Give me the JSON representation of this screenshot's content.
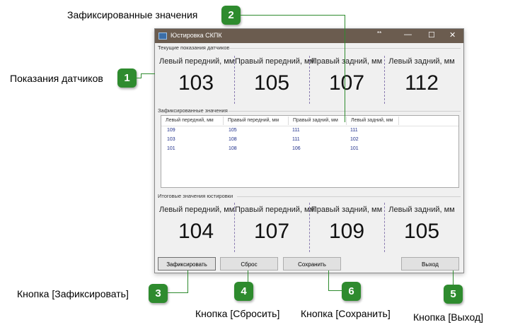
{
  "window": {
    "title": "Юстировка СКПК",
    "dots": "**",
    "controls": {
      "minimize": "—",
      "maximize": "☐",
      "close": "✕"
    }
  },
  "current_group": {
    "label": "Текущие показания датчиков",
    "sensors": [
      {
        "label": "Левый передний, мм",
        "value": "103"
      },
      {
        "label": "Правый передний, мм",
        "value": "105"
      },
      {
        "label": "Правый задний, мм",
        "value": "107"
      },
      {
        "label": "Левый задний, мм",
        "value": "112"
      }
    ]
  },
  "fixed_group": {
    "label": "Зафиксированные значения",
    "columns": [
      "Левый передний, мм",
      "Правый передний, мм",
      "Правый задний, мм",
      "Левый задний, мм"
    ],
    "rows": [
      [
        "109",
        "105",
        "111",
        "111"
      ],
      [
        "103",
        "108",
        "111",
        "102"
      ],
      [
        "101",
        "108",
        "106",
        "101"
      ]
    ]
  },
  "final_group": {
    "label": "Итоговые значения юстировки",
    "sensors": [
      {
        "label": "Левый передний, мм",
        "value": "104"
      },
      {
        "label": "Правый передний, мм",
        "value": "107"
      },
      {
        "label": "Правый задний, мм",
        "value": "109"
      },
      {
        "label": "Левый задний, мм",
        "value": "105"
      }
    ]
  },
  "buttons": {
    "fix": "Зафиксировать",
    "reset": "Сброс",
    "save": "Сохранить",
    "exit": "Выход"
  },
  "annotations": {
    "a1": {
      "num": "1",
      "text": "Показания датчиков"
    },
    "a2": {
      "num": "2",
      "text": "Зафиксированные значения"
    },
    "a3": {
      "num": "3",
      "text": "Кнопка [Зафиксировать]"
    },
    "a4": {
      "num": "4",
      "text": "Кнопка [Сбросить]"
    },
    "a5": {
      "num": "5",
      "text": "Кнопка [Выход]"
    },
    "a6": {
      "num": "6",
      "text": "Кнопка [Сохранить]"
    }
  },
  "colors": {
    "badge": "#2e8b2e",
    "titlebar": "#6b5c4f",
    "table_text": "#1d2d8a"
  }
}
